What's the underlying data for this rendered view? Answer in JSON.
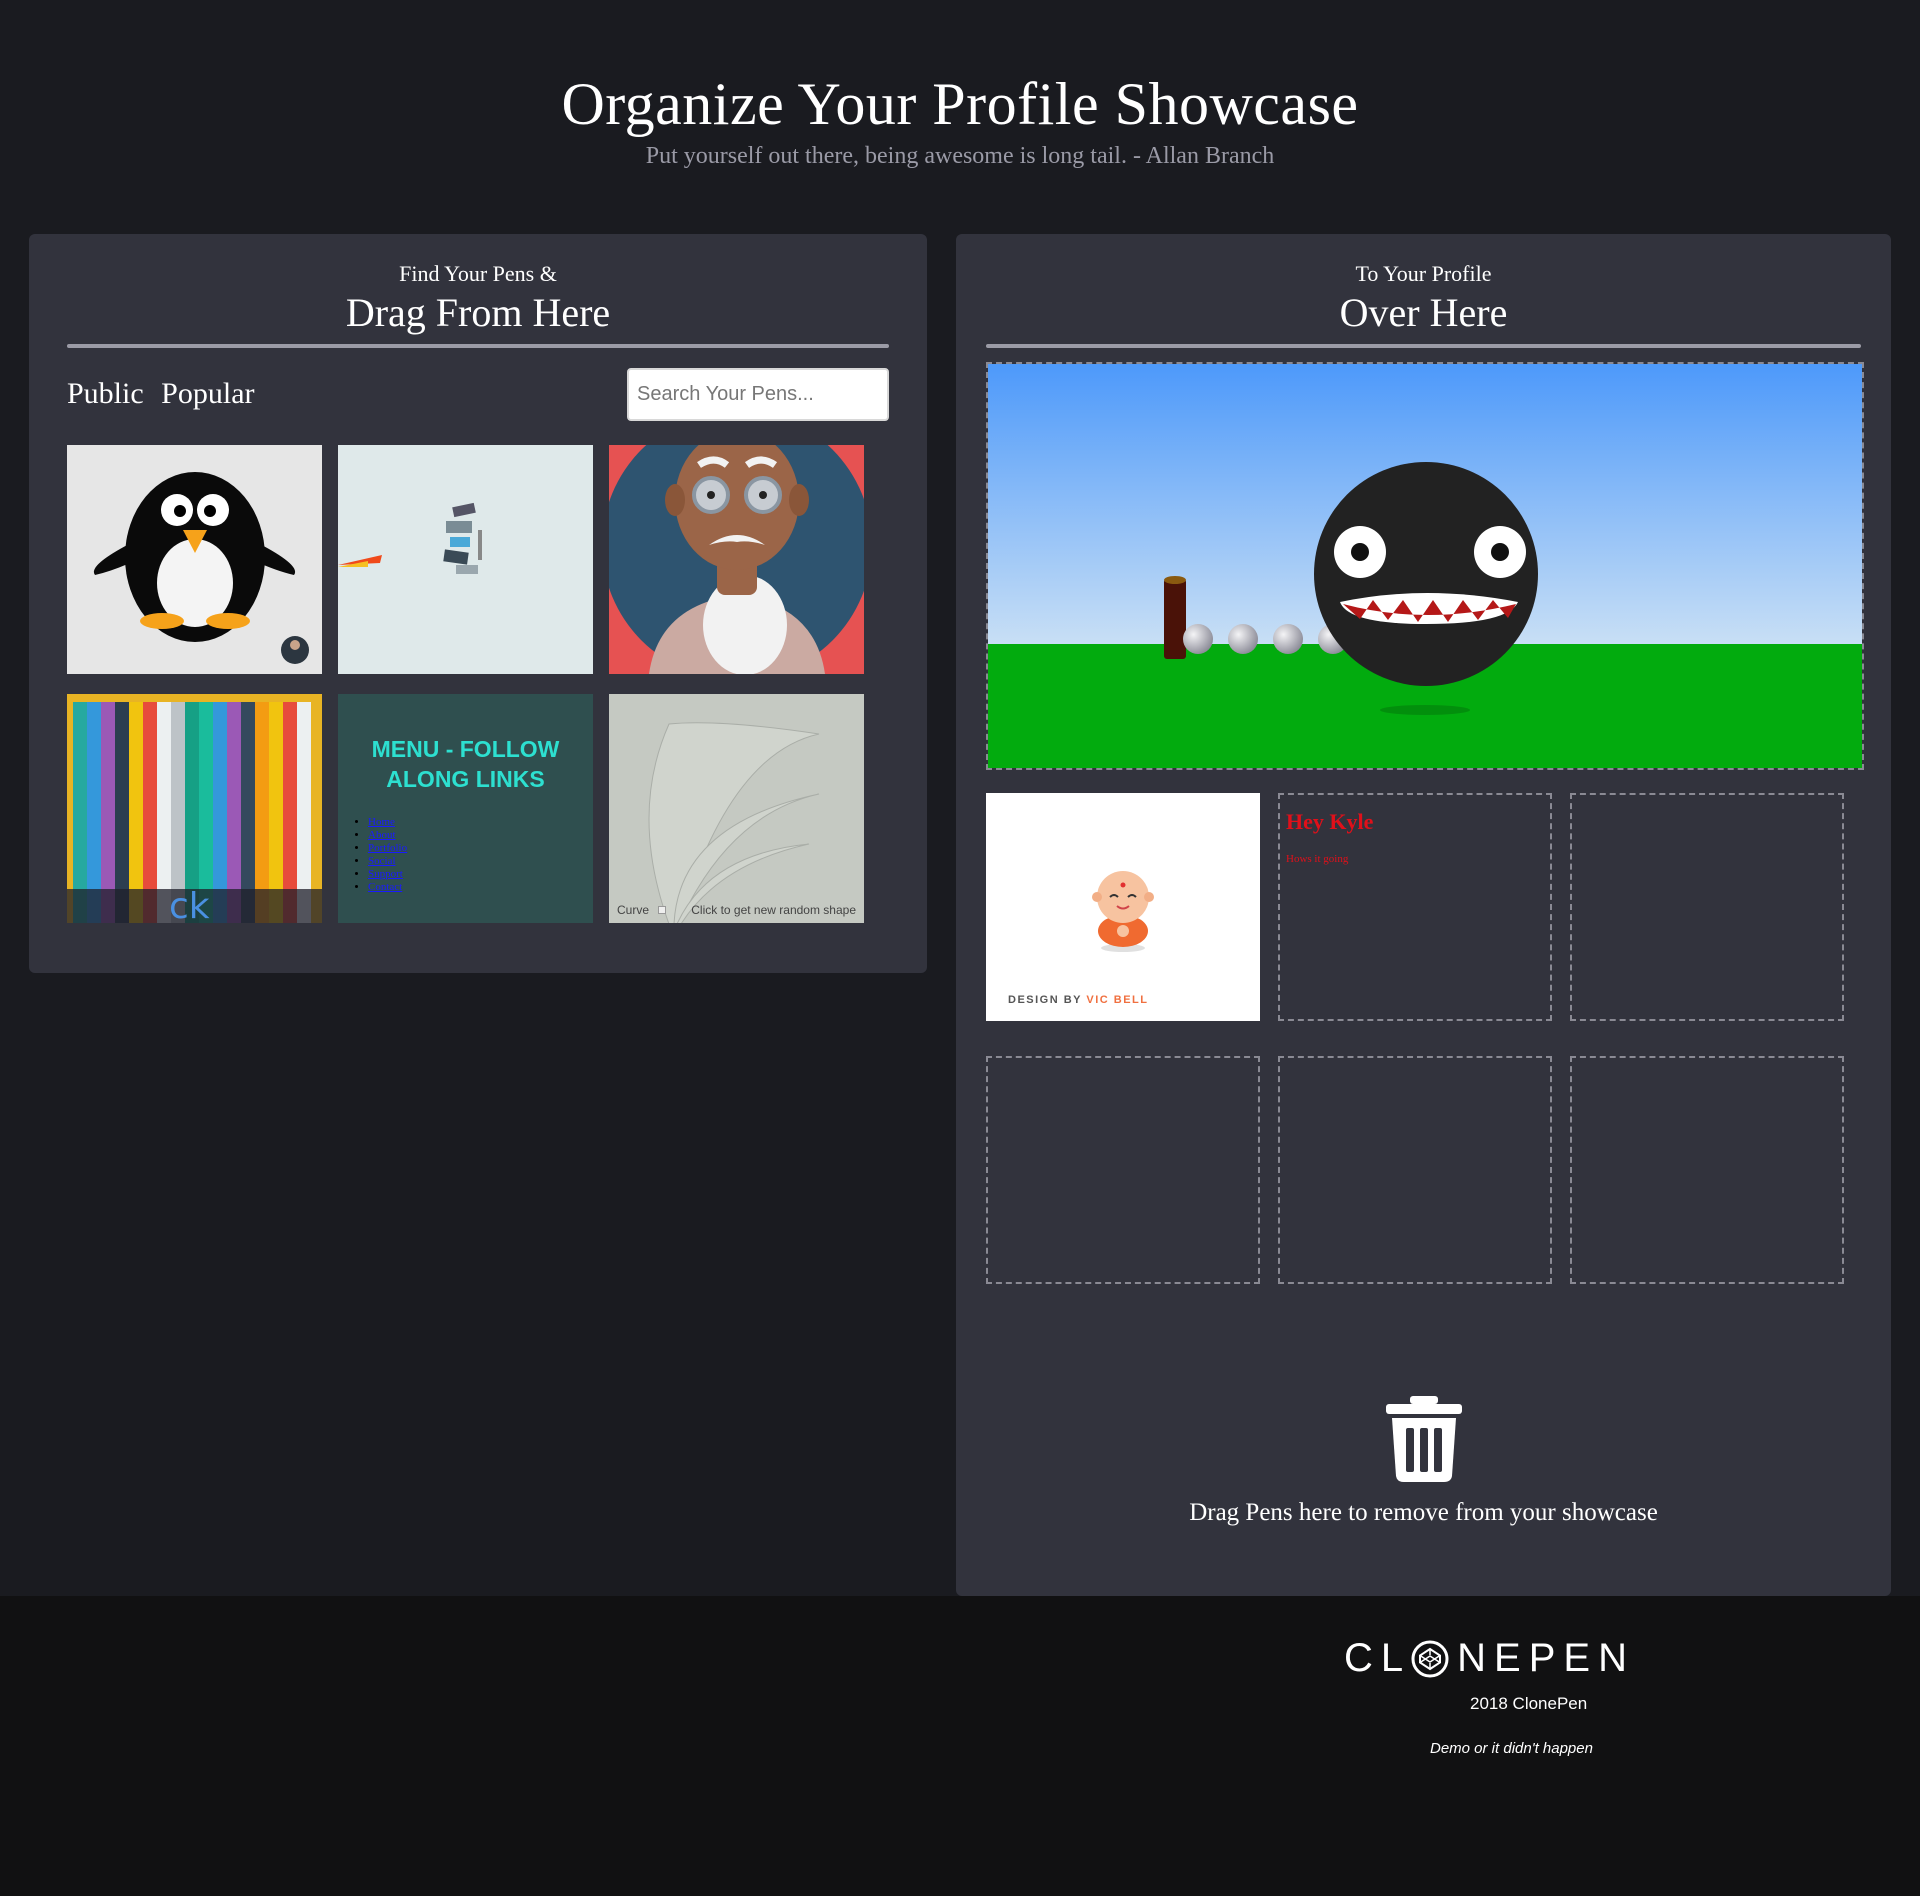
{
  "header": {
    "title": "Organize Your Profile Showcase",
    "subtitle": "Put yourself out there, being awesome is long tail. - Allan Branch"
  },
  "left": {
    "small": "Find Your Pens &",
    "big": "Drag From Here",
    "filters": [
      "Public",
      "Popular"
    ],
    "search_placeholder": "Search Your Pens...",
    "menu_pen": {
      "title": "MENU - FOLLOW ALONG LINKS",
      "links": [
        "Home",
        "About",
        "Portfolio",
        "Social",
        "Support",
        "Contact"
      ]
    },
    "curve_pen": {
      "label": "Curve",
      "hint": "Click to get new random shape"
    },
    "stripes_text": "ck"
  },
  "right": {
    "small": "To Your Profile",
    "big": "Over Here",
    "design_pen": {
      "prefix": "DESIGN BY",
      "name": "VIC BELL"
    },
    "kyle_pen": {
      "title": "Hey Kyle",
      "text": "Hows it going"
    },
    "trash_label": "Drag Pens here to remove from your showcase"
  },
  "footer": {
    "logo_left": "CL",
    "logo_right": "NEPEN",
    "copyright": "2018 ClonePen",
    "tagline": "Demo or it didn't happen"
  },
  "colors": {
    "background": "#1a1b20",
    "panel": "#32333d",
    "footer": "#111112",
    "menu_text": "#2de0d0",
    "kyle_red": "#e0101a",
    "vic_orange": "#f07040"
  }
}
